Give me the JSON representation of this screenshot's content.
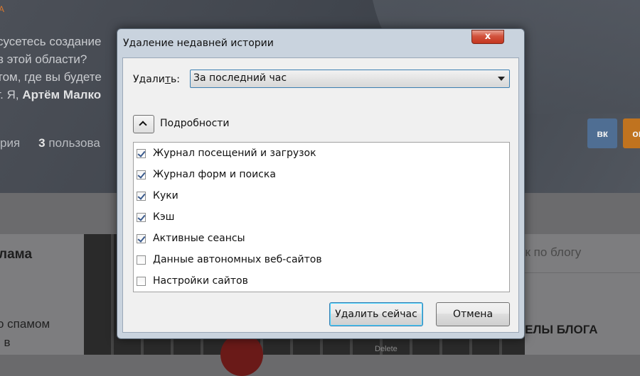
{
  "background_site": {
    "brand_fragment": "A",
    "hero_lines": [
      "сусетесь создание",
      "в этой области?",
      "том, где вы будете",
      "г. Я,"
    ],
    "hero_name": "Артём Малко",
    "stats_text": "рия",
    "stats_count": "3",
    "stats_suffix": "пользова",
    "vk_label": "вк",
    "ok_label": "ок",
    "post_title": "лама",
    "post_body_lines": [
      "о спамом",
      ", в"
    ],
    "key_label": "Delete",
    "search_placeholder": "ск по блогу",
    "sections_title": "ДЕЛЫ БЛОГА"
  },
  "dialog": {
    "title": "Удаление недавней истории",
    "close_glyph": "x",
    "remove_label_pre": "Удали",
    "remove_label_accel": "т",
    "remove_label_post": "ь:",
    "time_range": "За последний час",
    "details_label": "Подробности",
    "items": [
      {
        "label": "Журнал посещений и загрузок",
        "checked": true
      },
      {
        "label": "Журнал форм и поиска",
        "checked": true
      },
      {
        "label": "Куки",
        "checked": true
      },
      {
        "label": "Кэш",
        "checked": true
      },
      {
        "label": "Активные сеансы",
        "checked": true
      },
      {
        "label": "Данные автономных веб-сайтов",
        "checked": false
      },
      {
        "label": "Настройки сайтов",
        "checked": false
      }
    ],
    "clear_now_label": "Удалить сейчас",
    "cancel_label": "Отмена"
  },
  "colors": {
    "accent_orange": "#d9772e",
    "vk_blue": "#4f6e93",
    "close_red": "#c4361f",
    "focus_blue": "#3c7fb1"
  }
}
